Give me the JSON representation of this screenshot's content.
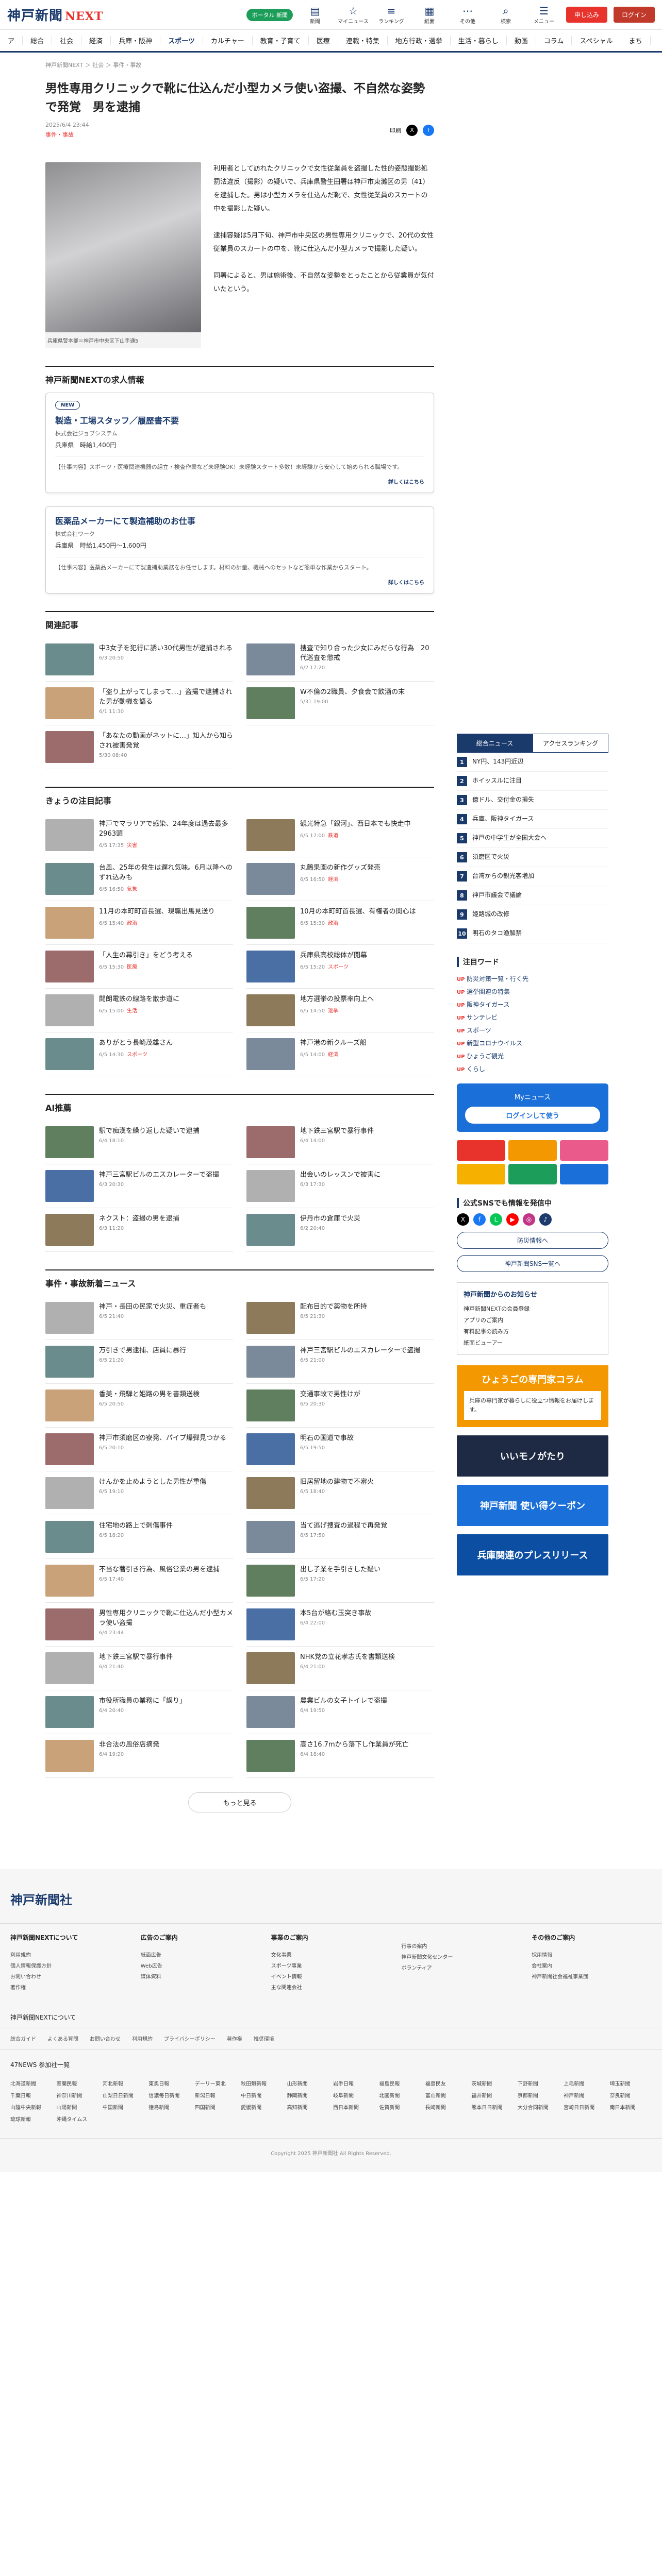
{
  "header": {
    "logo": "神戸新聞",
    "logo_accent": "NEXT",
    "pill": "ポータル 新聞",
    "icons": [
      "新聞",
      "マイニュース",
      "ランキング",
      "紙面",
      "その他",
      "検索",
      "メニュー"
    ],
    "login": "ログイン",
    "signup": "申し込み"
  },
  "nav": [
    "ア",
    "総合",
    "社会",
    "経済",
    "兵庫・阪神",
    "スポーツ",
    "カルチャー",
    "教育・子育て",
    "医療",
    "連載・特集",
    "地方行政・選挙",
    "生活・暮らし",
    "動画",
    "コラム",
    "スペシャル",
    "まち"
  ],
  "breadcrumb": "神戸新聞NEXT ＞ 社会 ＞ 事件・事故",
  "article": {
    "title": "男性専用クリニックで靴に仕込んだ小型カメラ使い盗撮、不自然な姿勢で発覚　男を逮捕",
    "date": "2025/6/4 23:44",
    "tag": "事件・事故",
    "share_label": "印刷",
    "caption": "兵庫県警本部＝神戸市中央区下山手通5",
    "paragraphs": [
      "利用者として訪れたクリニックで女性従業員を盗撮した性的姿態撮影処罰法違反（撮影）の疑いで、兵庫県警生田署は神戸市東灘区の男（41）を逮捕した。男は小型カメラを仕込んだ靴で、女性従業員のスカートの中を撮影した疑い。",
      "逮捕容疑は5月下旬、神戸市中央区の男性専用クリニックで、20代の女性従業員のスカートの中を、靴に仕込んだ小型カメラで撮影した疑い。",
      "同署によると、男は施術後、不自然な姿勢をとったことから従業員が気付いたという。"
    ]
  },
  "jobs_section": "神戸新聞NEXTの求人情報",
  "jobs": [
    {
      "badge": "NEW",
      "title": "製造・工場スタッフ／履歴書不要",
      "company": "株式会社ジョブシステム",
      "loc": "兵庫県",
      "pay": "時給1,400円",
      "text": "【仕事内容】スポーツ・医療関連機器の組立・検査作業など未経験OK！未経験スタート多数！未経験から安心して始められる職場です。",
      "more": "詳しくはこちら"
    },
    {
      "badge": "",
      "title": "医薬品メーカーにて製造補助のお仕事",
      "company": "株式会社ワーク",
      "loc": "兵庫県",
      "pay": "時給1,450円〜1,600円",
      "text": "【仕事内容】医薬品メーカーにて製造補助業務をお任せします。材料の計量、機械へのセットなど簡単な作業からスタート。",
      "more": "詳しくはこちら"
    }
  ],
  "related_title": "関連記事",
  "related": [
    {
      "t": "中3女子を犯行に誘い30代男性が逮捕される",
      "d": "6/3 20:50"
    },
    {
      "t": "捜査で知り合った少女にみだらな行為　20代巡査を懲戒",
      "d": "6/2 17:20"
    },
    {
      "t": "「盗り上がってしまって…」盗撮で逮捕された男が動機を語る",
      "d": "6/1 11:30"
    },
    {
      "t": "W不倫の2職員、夕食会で飲酒の末",
      "d": "5/31 19:00"
    },
    {
      "t": "「あなたの動画がネットに…」知人から知らされ被害発覚",
      "d": "5/30 08:40"
    }
  ],
  "today_title": "きょうの注目記事",
  "today": [
    {
      "t": "神戸でマラリアで感染、24年度は過去最多2963頭",
      "d": "6/5 17:35",
      "b": "災害"
    },
    {
      "t": "観光特急「銀河」、西日本でも快走中",
      "d": "6/5 17:00",
      "b": "鉄道"
    },
    {
      "t": "台風、25年の発生は遅れ気味。6月以降へのずれ込みも",
      "d": "6/5 16:50",
      "b": "気象"
    },
    {
      "t": "丸鶴果園の新作グッズ発売",
      "d": "6/5 16:50",
      "b": "経済"
    },
    {
      "t": "11月の本町町首長選、現職出馬見送り",
      "d": "6/5 15:40",
      "b": "政治"
    },
    {
      "t": "10月の本町町首長選、有権者の関心は",
      "d": "6/5 15:30",
      "b": "政治"
    },
    {
      "t": "「人生の幕引き」をどう考える",
      "d": "6/5 15:30",
      "b": "医療"
    },
    {
      "t": "兵庫県高校総体が開幕",
      "d": "6/5 15:20",
      "b": "スポーツ"
    },
    {
      "t": "闘朗電鉄の線路を散歩道に",
      "d": "6/5 15:00",
      "b": "生活"
    },
    {
      "t": "地方選挙の投票率向上へ",
      "d": "6/5 14:50",
      "b": "選挙"
    },
    {
      "t": "ありがとう長崎茂雄さん",
      "d": "6/5 14:30",
      "b": "スポーツ"
    },
    {
      "t": "神戸港の新クルーズ船",
      "d": "6/5 14:00",
      "b": "経済"
    }
  ],
  "ai_title": "AI推薦",
  "ai": [
    {
      "t": "駅で痴漢を繰り返した疑いで逮捕",
      "d": "6/4 18:10"
    },
    {
      "t": "地下鉄三宮駅で暴行事件",
      "d": "6/4 14:00"
    },
    {
      "t": "神戸三宮駅ビルのエスカレーターで盗撮",
      "d": "6/3 20:30"
    },
    {
      "t": "出会いのレッスンで被害に",
      "d": "6/3 17:30"
    },
    {
      "t": "ネクスト：盗撮の男を逮捕",
      "d": "6/3 11:20"
    },
    {
      "t": "伊丹市の倉庫で火災",
      "d": "6/2 20:40"
    }
  ],
  "crime_title": "事件・事故新着ニュース",
  "crime": [
    {
      "t": "神戸・長田の民家で火災、重症者も",
      "d": "6/5 21:40"
    },
    {
      "t": "配布目的で薬物を所持",
      "d": "6/5 21:30"
    },
    {
      "t": "万引きで男逮捕、店員に暴行",
      "d": "6/5 21:20"
    },
    {
      "t": "神戸三宮駅ビルのエスカレーターで盗撮",
      "d": "6/5 21:00"
    },
    {
      "t": "香美・飛騨と姫路の男を書類送検",
      "d": "6/5 20:50"
    },
    {
      "t": "交通事故で男性けが",
      "d": "6/5 20:30"
    },
    {
      "t": "神戸市須磨区の寮発、パイプ爆弾見つかる",
      "d": "6/5 20:10"
    },
    {
      "t": "明石の国道で事故",
      "d": "6/5 19:50"
    },
    {
      "t": "けんかを止めようとした男性が重傷",
      "d": "6/5 19:10"
    },
    {
      "t": "旧居留地の建物で不審火",
      "d": "6/5 18:40"
    },
    {
      "t": "住宅地の路上で刺傷事件",
      "d": "6/5 18:20"
    },
    {
      "t": "当て逃げ捜査の過程で再発覚",
      "d": "6/5 17:50"
    },
    {
      "t": "不当な著引き行為、風俗営業の男を逮捕",
      "d": "6/5 17:40"
    },
    {
      "t": "出し子業を手引きした疑い",
      "d": "6/5 17:20"
    },
    {
      "t": "男性専用クリニックで靴に仕込んだ小型カメラ使い盗撮",
      "d": "6/4 23:44"
    },
    {
      "t": "本5台が絡む玉突き事故",
      "d": "6/4 22:00"
    },
    {
      "t": "地下鉄三宮駅で暴行事件",
      "d": "6/4 21:40"
    },
    {
      "t": "NHK党の立花孝志氏を書類送検",
      "d": "6/4 21:00"
    },
    {
      "t": "市役所職員の業務に「誤り」",
      "d": "6/4 20:40"
    },
    {
      "t": "農業ビルの女子トイレで盗撮",
      "d": "6/4 19:50"
    },
    {
      "t": "非合法の風俗店摘発",
      "d": "6/4 19:20"
    },
    {
      "t": "高さ16.7mから落下し作業員が死亡",
      "d": "6/4 18:40"
    }
  ],
  "more_label": "もっと見る",
  "side": {
    "tabs": [
      "総合ニュース",
      "アクセスランキング"
    ],
    "rank": [
      "NY円、143円近辺",
      "ホイッスルに注目",
      "億ドル、交付金の損失",
      "兵庫、阪神タイガース",
      "神戸の中学生が全国大会へ",
      "須磨区で火災",
      "台湾からの観光客増加",
      "神戸市議会で議論",
      "姫路城の改修",
      "明石のタコ漁解禁"
    ],
    "words_title": "注目ワード",
    "words": [
      "防災対策一覧・行く先",
      "選挙関連の特集",
      "阪神タイガース",
      "サンテレビ",
      "スポーツ",
      "新型コロナウイルス",
      "ひょうご観光",
      "くらし"
    ],
    "my_title": "Myニュース",
    "my_login": "ログインして使う",
    "sns_title": "公式SNSでも情報を発信中",
    "out1": "防災情報へ",
    "out2": "神戸新聞SNS一覧へ",
    "notice_title": "神戸新聞からのお知らせ",
    "notices": [
      "神戸新聞NEXTの会員登録",
      "アプリのご案内",
      "有料記事の読み方",
      "紙面ビューアー"
    ],
    "kobe_title": "ひょうごの専門家コラム",
    "kobe_text": "兵庫の専門家が暮らしに役立つ情報をお届けします。",
    "b1": "いいモノがたり",
    "b2": "神戸新聞 使い得クーポン",
    "b3": "兵庫関連のプレスリリース"
  },
  "footer": {
    "logo": "神戸新聞社",
    "cols": [
      {
        "h": "神戸新聞NEXTについて",
        "p": [
          "利用規約",
          "個人情報保護方針",
          "お問い合わせ",
          "著作権"
        ]
      },
      {
        "h": "広告のご案内",
        "p": [
          "紙面広告",
          "Web広告",
          "媒体資料"
        ]
      },
      {
        "h": "事業のご案内",
        "p": [
          "文化事業",
          "スポーツ事業",
          "イベント情報",
          "主な関連会社"
        ]
      },
      {
        "h": "",
        "p": [
          "行事の案内",
          "神戸新聞文化センター",
          "ボランティア"
        ]
      },
      {
        "h": "その他のご案内",
        "p": [
          "採用情報",
          "会社案内",
          "神戸新聞社会福祉事業団"
        ]
      }
    ],
    "next": "神戸新聞NEXTについて",
    "links": [
      "総合ガイド",
      "よくある質問",
      "お問い合わせ",
      "利用規約",
      "プライバシーポリシー",
      "著作権",
      "推奨環境"
    ],
    "n47": "47NEWS 参加社一覧",
    "prefs": [
      "北海道新聞",
      "室蘭民報",
      "河北新報",
      "東奥日報",
      "デーリー東北",
      "秋田魁新報",
      "山形新聞",
      "岩手日報",
      "福島民報",
      "福島民友",
      "茨城新聞",
      "下野新聞",
      "上毛新聞",
      "埼玉新聞",
      "千葉日報",
      "神奈川新聞",
      "山梨日日新聞",
      "信濃毎日新聞",
      "新潟日報",
      "中日新聞",
      "静岡新聞",
      "岐阜新聞",
      "北國新聞",
      "富山新聞",
      "福井新聞",
      "京都新聞",
      "神戸新聞",
      "奈良新聞",
      "山陰中央新報",
      "山陽新聞",
      "中国新聞",
      "徳島新聞",
      "四国新聞",
      "愛媛新聞",
      "高知新聞",
      "西日本新聞",
      "佐賀新聞",
      "長崎新聞",
      "熊本日日新聞",
      "大分合同新聞",
      "宮崎日日新聞",
      "南日本新聞",
      "琉球新報",
      "沖縄タイムス"
    ],
    "copy": "Copyright 2025 神戸新聞社 All Rights Reserved."
  }
}
